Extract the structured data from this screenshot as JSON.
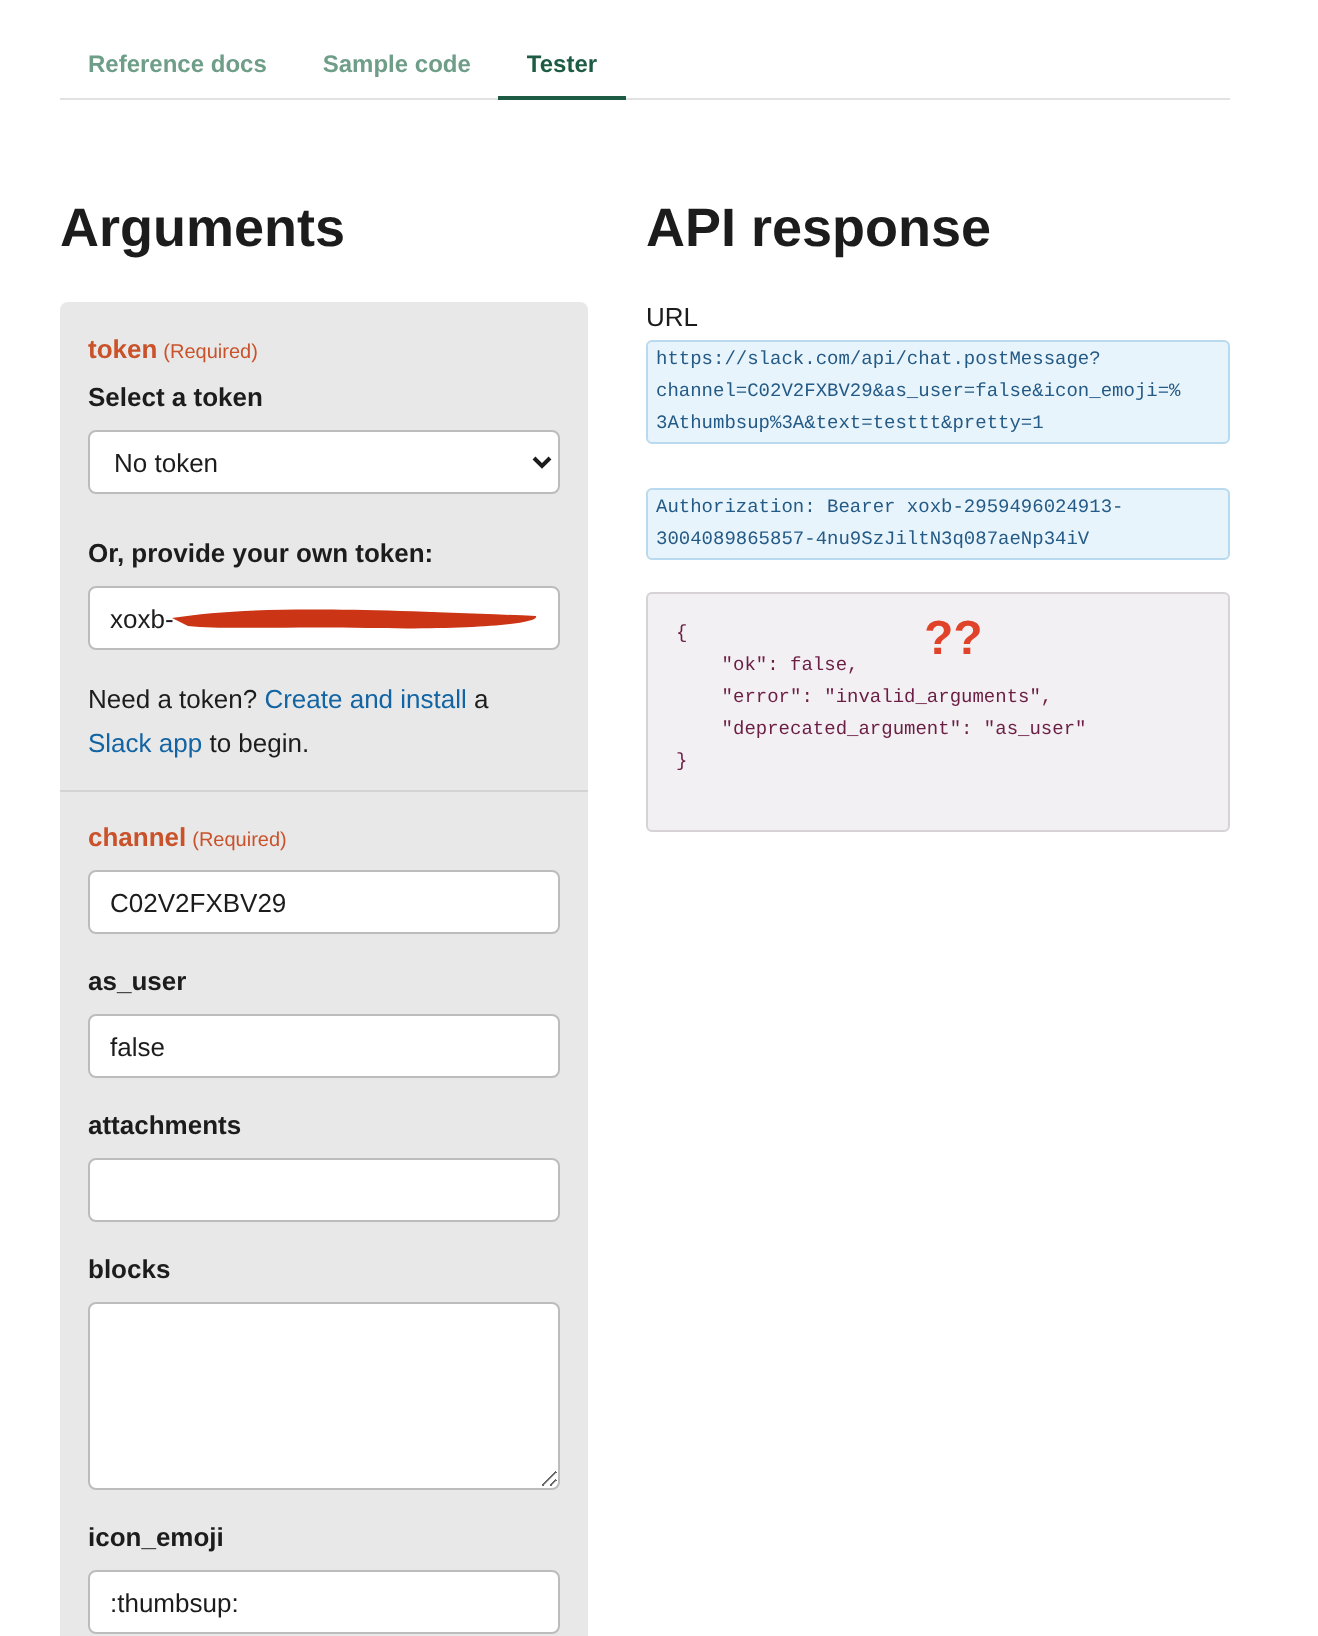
{
  "tabs": [
    {
      "label": "Reference docs",
      "selected": false
    },
    {
      "label": "Sample code",
      "selected": false
    },
    {
      "label": "Tester",
      "selected": true
    }
  ],
  "arguments": {
    "title": "Arguments",
    "token": {
      "name": "token",
      "required_note": "(Required)",
      "select_label": "Select a token",
      "select_value": "No token",
      "own_label": "Or, provide your own token:",
      "own_value": "xoxb-",
      "help": [
        {
          "text": "Need a token?",
          "link": false
        },
        {
          "text": "Create and install",
          "link": true
        },
        {
          "text": "a",
          "link": false
        },
        {
          "text": "Slack app",
          "link": true
        },
        {
          "text": "to begin.",
          "link": false
        }
      ]
    },
    "params": [
      {
        "name": "channel",
        "required": true,
        "required_note": "(Required)",
        "kind": "text",
        "value": "C02V2FXBV29"
      },
      {
        "name": "as_user",
        "required": false,
        "kind": "text",
        "value": "false"
      },
      {
        "name": "attachments",
        "required": false,
        "kind": "text"
      },
      {
        "name": "blocks",
        "required": false,
        "kind": "textarea"
      },
      {
        "name": "icon_emoji",
        "required": false,
        "kind": "text",
        "value": ":thumbsup:"
      }
    ]
  },
  "response": {
    "title": "API response",
    "url_label": "URL",
    "url_lines": [
      "https://slack.com/api/chat.postMessage?",
      "channel=C02V2FXBV29&as_user=false&icon_emoji=%",
      "3Athumbsup%3A&text=testtt&pretty=1"
    ],
    "auth_lines": [
      "Authorization: Bearer xoxb-2959496024913-",
      "3004089865857-4nu9SzJiltN3q087aeNp34iV"
    ],
    "json_lines": [
      "{",
      "    \"ok\": false,",
      "    \"error\": \"invalid_arguments\",",
      "    \"deprecated_argument\": \"as_user\"",
      "}"
    ],
    "annotation": "??"
  }
}
